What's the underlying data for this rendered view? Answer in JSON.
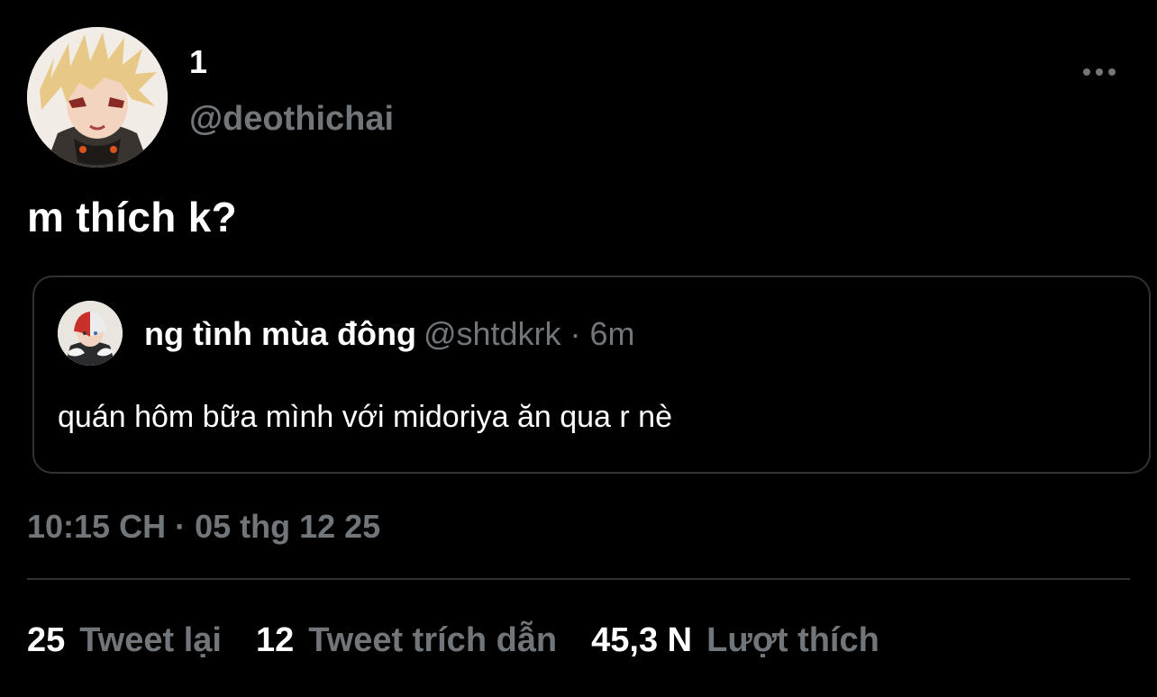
{
  "author": {
    "display_name": "1",
    "handle": "@deothichai",
    "avatar_icon": "anime-avatar-blonde"
  },
  "tweet": {
    "text": "m thích k?",
    "timestamp": "10:15 CH · 05 thg 12 25"
  },
  "quoted_tweet": {
    "display_name": "ng tình mùa đông",
    "meta": "@shtdkrk · 6m",
    "text": "quán hôm bữa mình với midoriya ăn qua r nè",
    "avatar_icon": "anime-avatar-red-white"
  },
  "stats": {
    "retweets_count": "25",
    "retweets_label": "Tweet lại",
    "quotes_count": "12",
    "quotes_label": "Tweet trích dẫn",
    "likes_count": "45,3 N",
    "likes_label": "Lượt thích"
  },
  "colors": {
    "background": "#000000",
    "primary_text": "#ffffff",
    "secondary_text": "#71767b",
    "border": "#2f3336"
  }
}
